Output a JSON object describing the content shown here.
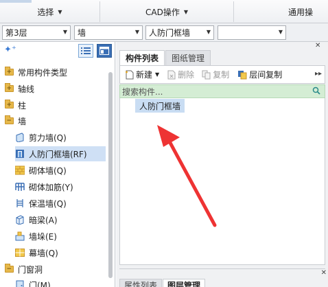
{
  "ribbon": {
    "groups": [
      {
        "label": "选择"
      },
      {
        "label": "CAD操作"
      },
      {
        "label": "通用操"
      }
    ]
  },
  "filters": {
    "floor": "第3层",
    "category": "墙",
    "subtype": "人防门框墙",
    "component": ""
  },
  "tree": {
    "items": [
      {
        "label": "常用构件类型",
        "kind": "folder",
        "sign": "+"
      },
      {
        "label": "轴线",
        "kind": "folder",
        "sign": "+"
      },
      {
        "label": "柱",
        "kind": "folder",
        "sign": "+"
      },
      {
        "label": "墙",
        "kind": "folder",
        "sign": "−"
      },
      {
        "label": "剪力墙(Q)",
        "kind": "leaf",
        "icon": "shear-wall-icon"
      },
      {
        "label": "人防门框墙(RF)",
        "kind": "leaf",
        "icon": "civil-defense-door-wall-icon",
        "selected": true
      },
      {
        "label": "砌体墙(Q)",
        "kind": "leaf",
        "icon": "masonry-wall-icon"
      },
      {
        "label": "砌体加筋(Y)",
        "kind": "leaf",
        "icon": "masonry-reinforcement-icon"
      },
      {
        "label": "保温墙(Q)",
        "kind": "leaf",
        "icon": "insulation-wall-icon"
      },
      {
        "label": "暗梁(A)",
        "kind": "leaf",
        "icon": "hidden-beam-icon"
      },
      {
        "label": "墙垛(E)",
        "kind": "leaf",
        "icon": "wall-pier-icon"
      },
      {
        "label": "幕墙(Q)",
        "kind": "leaf",
        "icon": "curtain-wall-icon"
      },
      {
        "label": "门窗洞",
        "kind": "folder",
        "sign": "−"
      },
      {
        "label": "门(M)",
        "kind": "leaf",
        "icon": "door-icon"
      }
    ]
  },
  "panel": {
    "tabs": [
      "构件列表",
      "图纸管理"
    ],
    "toolbar": {
      "new_label": "新建",
      "delete_label": "删除",
      "copy_label": "复制",
      "floor_copy_label": "层间复制"
    },
    "search_placeholder": "搜索构件...",
    "list_items": [
      "人防门框墙"
    ],
    "bottom_tabs": [
      "属性列表",
      "图层管理"
    ]
  },
  "annotation": {
    "arrow_color": "#ee3333"
  }
}
